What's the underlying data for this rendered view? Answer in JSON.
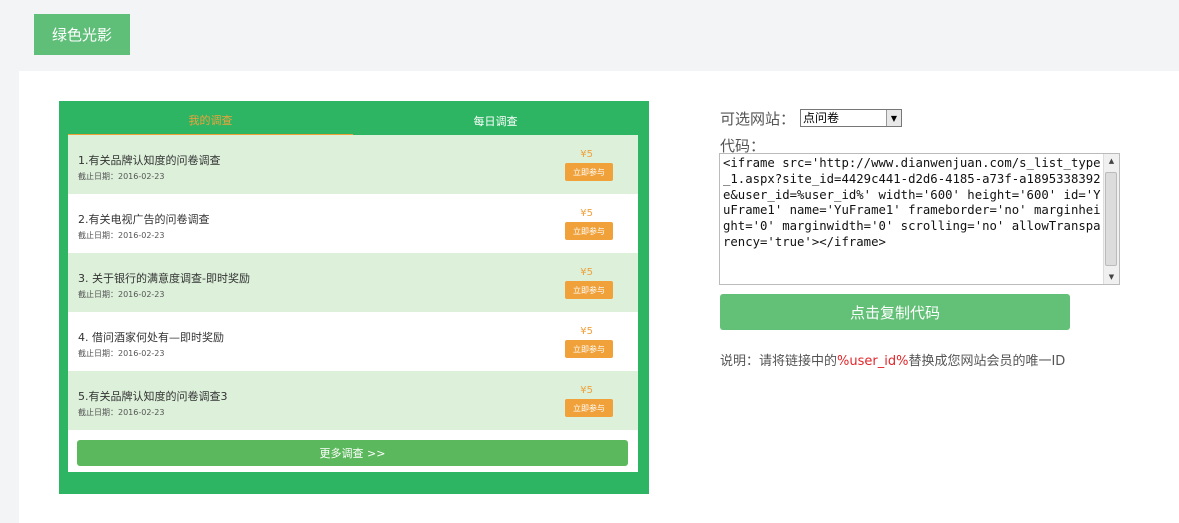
{
  "theme": {
    "label": "绿色光影"
  },
  "widget": {
    "tabs": [
      "我的调查",
      "每日调查"
    ],
    "items": [
      {
        "title": "1.有关品牌认知度的问卷调查",
        "date": "截止日期：2016-02-23",
        "price": "¥5",
        "action": "立即参与"
      },
      {
        "title": "2.有关电视广告的问卷调查",
        "date": "截止日期：2016-02-23",
        "price": "¥5",
        "action": "立即参与"
      },
      {
        "title": "3. 关于银行的满意度调查-即时奖励",
        "date": "截止日期：2016-02-23",
        "price": "¥5",
        "action": "立即参与"
      },
      {
        "title": "4. 借问酒家何处有—即时奖励",
        "date": "截止日期：2016-02-23",
        "price": "¥5",
        "action": "立即参与"
      },
      {
        "title": "5.有关品牌认知度的问卷调查3",
        "date": "截止日期：2016-02-23",
        "price": "¥5",
        "action": "立即参与"
      }
    ],
    "more": "更多调查 >>"
  },
  "form": {
    "site_label": "可选网站：",
    "site_value": "点问卷",
    "code_label": "代码：",
    "code": "<iframe src='http://www.dianwenjuan.com/s_list_type_1.aspx?site_id=4429c441-d2d6-4185-a73f-a1895338392e&user_id=%user_id%' width='600' height='600' id='YuFrame1' name='YuFrame1' frameborder='no' marginheight='0' marginwidth='0' scrolling='no' allowTransparency='true'></iframe>",
    "copy_button": "点击复制代码",
    "note_prefix": "说明：请将链接中的",
    "note_highlight": "%user_id%",
    "note_suffix": "替换成您网站会员的唯一ID"
  },
  "colors": {
    "green": "#2db563",
    "button_green": "#62c077",
    "orange": "#f0a13a",
    "highlight_red": "#e2262a"
  }
}
